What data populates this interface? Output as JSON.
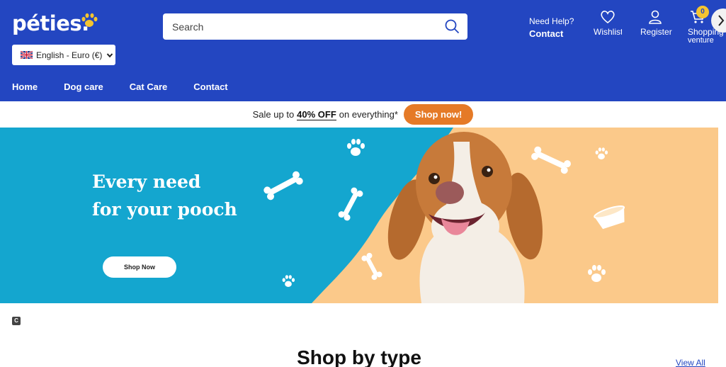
{
  "header": {
    "logo": "péties.",
    "language": "English - Euro (€)",
    "search_placeholder": "Search",
    "help_line1": "Need Help?",
    "help_line2": "Contact",
    "wishlist": "Wishlist",
    "register": "Register",
    "cart_label": "Shopping",
    "cart_sub": "venture",
    "cart_count": "0"
  },
  "nav": {
    "items": [
      "Home",
      "Dog care",
      "Cat Care",
      "Contact"
    ]
  },
  "promo": {
    "prefix": "Sale up to",
    "highlight": "40% OFF",
    "suffix": "on everything*",
    "button": "Shop now!"
  },
  "hero": {
    "line1": "Every need",
    "line2": "for your pooch",
    "button": "Shop Now"
  },
  "section": {
    "icon_letter": "C",
    "title": "Shop by type",
    "view_all": "View All"
  },
  "colors": {
    "header_bg": "#2346c1",
    "promo_button": "#e57a27",
    "hero_blue": "#14a6cf",
    "hero_peach": "#fbc98a"
  }
}
